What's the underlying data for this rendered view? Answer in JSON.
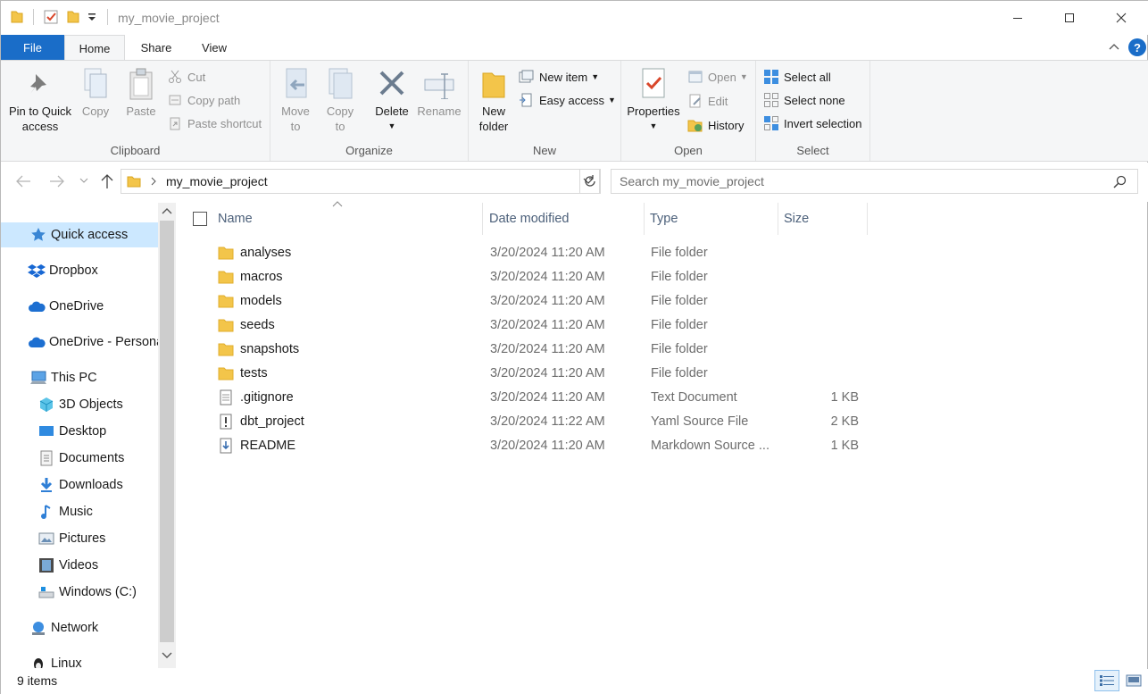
{
  "window": {
    "title": "my_movie_project"
  },
  "tabs": {
    "file": "File",
    "home": "Home",
    "share": "Share",
    "view": "View"
  },
  "ribbon": {
    "clipboard": {
      "label": "Clipboard",
      "pin_line1": "Pin to Quick",
      "pin_line2": "access",
      "copy": "Copy",
      "paste": "Paste",
      "cut": "Cut",
      "copy_path": "Copy path",
      "paste_shortcut": "Paste shortcut"
    },
    "organize": {
      "label": "Organize",
      "move_line1": "Move",
      "move_line2": "to",
      "copy_line1": "Copy",
      "copy_line2": "to",
      "delete": "Delete",
      "rename": "Rename"
    },
    "new": {
      "label": "New",
      "new_folder_line1": "New",
      "new_folder_line2": "folder",
      "new_item": "New item",
      "easy_access": "Easy access"
    },
    "open": {
      "label": "Open",
      "properties": "Properties",
      "open": "Open",
      "edit": "Edit",
      "history": "History"
    },
    "select": {
      "label": "Select",
      "select_all": "Select all",
      "select_none": "Select none",
      "invert_selection": "Invert selection"
    }
  },
  "address": {
    "path": "my_movie_project",
    "search_placeholder": "Search my_movie_project"
  },
  "nav": {
    "quick_access": "Quick access",
    "dropbox": "Dropbox",
    "onedrive": "OneDrive",
    "onedrive_personal": "OneDrive - Personal",
    "this_pc": "This PC",
    "objects3d": "3D Objects",
    "desktop": "Desktop",
    "documents": "Documents",
    "downloads": "Downloads",
    "music": "Music",
    "pictures": "Pictures",
    "videos": "Videos",
    "windows_c": "Windows (C:)",
    "network": "Network",
    "linux": "Linux"
  },
  "columns": {
    "name": "Name",
    "date": "Date modified",
    "type": "Type",
    "size": "Size"
  },
  "files": [
    {
      "name": "analyses",
      "date": "3/20/2024 11:20 AM",
      "type": "File folder",
      "size": "",
      "icon": "folder-icon"
    },
    {
      "name": "macros",
      "date": "3/20/2024 11:20 AM",
      "type": "File folder",
      "size": "",
      "icon": "folder-icon"
    },
    {
      "name": "models",
      "date": "3/20/2024 11:20 AM",
      "type": "File folder",
      "size": "",
      "icon": "folder-icon"
    },
    {
      "name": "seeds",
      "date": "3/20/2024 11:20 AM",
      "type": "File folder",
      "size": "",
      "icon": "folder-icon"
    },
    {
      "name": "snapshots",
      "date": "3/20/2024 11:20 AM",
      "type": "File folder",
      "size": "",
      "icon": "folder-icon"
    },
    {
      "name": "tests",
      "date": "3/20/2024 11:20 AM",
      "type": "File folder",
      "size": "",
      "icon": "folder-icon"
    },
    {
      "name": ".gitignore",
      "date": "3/20/2024 11:20 AM",
      "type": "Text Document",
      "size": "1 KB",
      "icon": "text-file-icon"
    },
    {
      "name": "dbt_project",
      "date": "3/20/2024 11:22 AM",
      "type": "Yaml Source File",
      "size": "2 KB",
      "icon": "yaml-file-icon"
    },
    {
      "name": "README",
      "date": "3/20/2024 11:20 AM",
      "type": "Markdown Source ...",
      "size": "1 KB",
      "icon": "markdown-file-icon"
    }
  ],
  "status": {
    "count": "9 items"
  },
  "colors": {
    "accent": "#1a6dc8",
    "selection": "#cce8ff",
    "folder": "#f3c54a"
  }
}
